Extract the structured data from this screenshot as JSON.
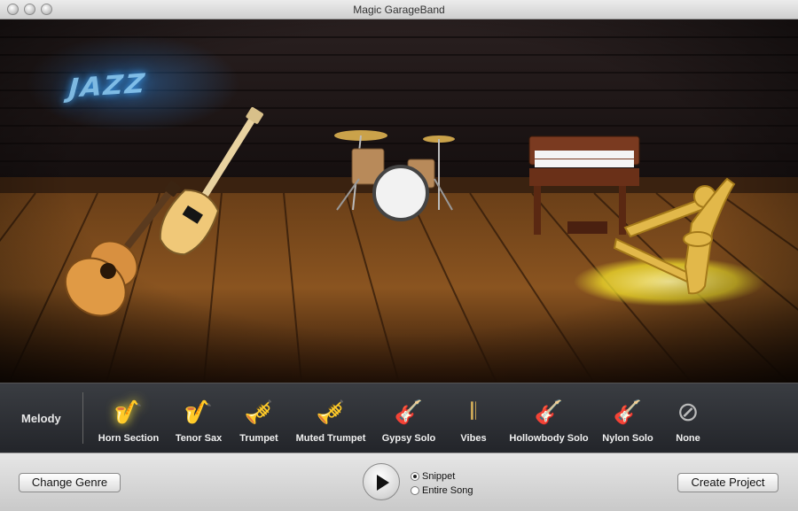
{
  "window": {
    "title": "Magic GarageBand"
  },
  "stage": {
    "neon_sign": "JAZZ"
  },
  "instrument_bar": {
    "section_label": "Melody",
    "selected": "Horn Section",
    "instruments": [
      {
        "label": "Horn Section",
        "icon": "horn-section-icon",
        "glyph": "🎷"
      },
      {
        "label": "Tenor Sax",
        "icon": "tenor-sax-icon",
        "glyph": "🎷"
      },
      {
        "label": "Trumpet",
        "icon": "trumpet-icon",
        "glyph": "🎺"
      },
      {
        "label": "Muted Trumpet",
        "icon": "muted-trumpet-icon",
        "glyph": "🎺"
      },
      {
        "label": "Gypsy Solo",
        "icon": "gypsy-guitar-icon",
        "glyph": "🎸"
      },
      {
        "label": "Vibes",
        "icon": "vibraphone-icon",
        "glyph": "𝄃"
      },
      {
        "label": "Hollowbody Solo",
        "icon": "hollowbody-guitar-icon",
        "glyph": "🎸"
      },
      {
        "label": "Nylon Solo",
        "icon": "nylon-guitar-icon",
        "glyph": "🎸"
      },
      {
        "label": "None",
        "icon": "none-icon",
        "glyph": "⊘"
      }
    ]
  },
  "bottom": {
    "change_genre": "Change Genre",
    "create_project": "Create Project",
    "playback_options": [
      {
        "label": "Snippet",
        "selected": true
      },
      {
        "label": "Entire Song",
        "selected": false
      }
    ]
  },
  "colors": {
    "spotlight": "#f2df2a",
    "floor": "#7a4a1c",
    "bar": "#2c2e33"
  }
}
